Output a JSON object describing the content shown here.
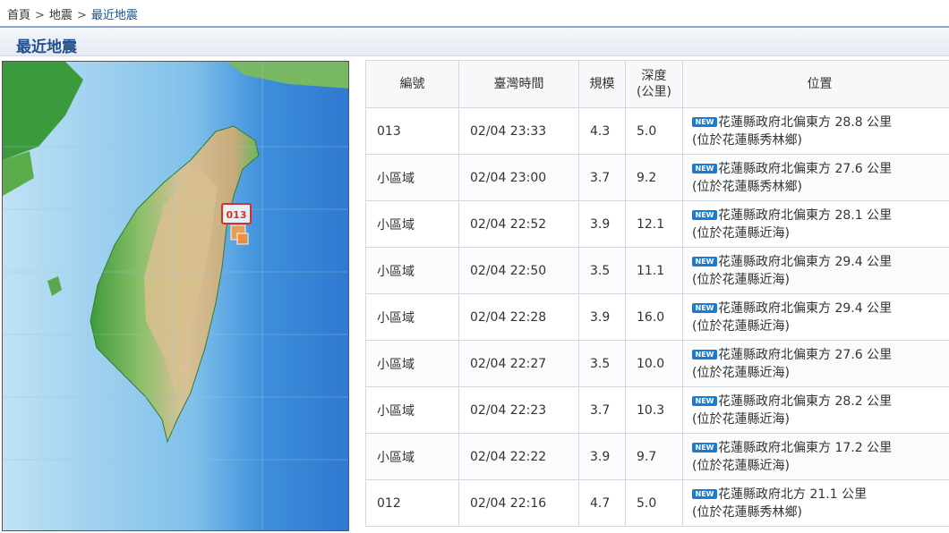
{
  "breadcrumb": {
    "home": "首頁",
    "sep1": ">",
    "section": "地震",
    "sep2": ">",
    "current": "最近地震"
  },
  "page_title": "最近地震",
  "map": {
    "marker_label": "013"
  },
  "table": {
    "headers": {
      "id": "編號",
      "time": "臺灣時間",
      "magnitude": "規模",
      "depth_line1": "深度",
      "depth_line2": "(公里)",
      "location": "位置"
    },
    "new_badge": "NEW",
    "rows": [
      {
        "id": "013",
        "time": "02/04 23:33",
        "magnitude": "4.3",
        "depth": "5.0",
        "loc1": "花蓮縣政府北偏東方 28.8 公里",
        "loc2": "(位於花蓮縣秀林鄉)"
      },
      {
        "id": "小區域",
        "time": "02/04 23:00",
        "magnitude": "3.7",
        "depth": "9.2",
        "loc1": "花蓮縣政府北偏東方 27.6 公里",
        "loc2": "(位於花蓮縣秀林鄉)"
      },
      {
        "id": "小區域",
        "time": "02/04 22:52",
        "magnitude": "3.9",
        "depth": "12.1",
        "loc1": "花蓮縣政府北偏東方 28.1 公里",
        "loc2": "(位於花蓮縣近海)"
      },
      {
        "id": "小區域",
        "time": "02/04 22:50",
        "magnitude": "3.5",
        "depth": "11.1",
        "loc1": "花蓮縣政府北偏東方 29.4 公里",
        "loc2": "(位於花蓮縣近海)"
      },
      {
        "id": "小區域",
        "time": "02/04 22:28",
        "magnitude": "3.9",
        "depth": "16.0",
        "loc1": "花蓮縣政府北偏東方 29.4 公里",
        "loc2": "(位於花蓮縣近海)"
      },
      {
        "id": "小區域",
        "time": "02/04 22:27",
        "magnitude": "3.5",
        "depth": "10.0",
        "loc1": "花蓮縣政府北偏東方 27.6 公里",
        "loc2": "(位於花蓮縣近海)"
      },
      {
        "id": "小區域",
        "time": "02/04 22:23",
        "magnitude": "3.7",
        "depth": "10.3",
        "loc1": "花蓮縣政府北偏東方 28.2 公里",
        "loc2": "(位於花蓮縣近海)"
      },
      {
        "id": "小區域",
        "time": "02/04 22:22",
        "magnitude": "3.9",
        "depth": "9.7",
        "loc1": "花蓮縣政府北偏東方 17.2 公里",
        "loc2": "(位於花蓮縣近海)"
      },
      {
        "id": "012",
        "time": "02/04 22:16",
        "magnitude": "4.7",
        "depth": "5.0",
        "loc1": "花蓮縣政府北方 21.1 公里",
        "loc2": "(位於花蓮縣秀林鄉)"
      }
    ]
  },
  "colors": {
    "title": "#1f4f8c",
    "badge": "#1b7ad1",
    "marker": "#d0322e"
  }
}
